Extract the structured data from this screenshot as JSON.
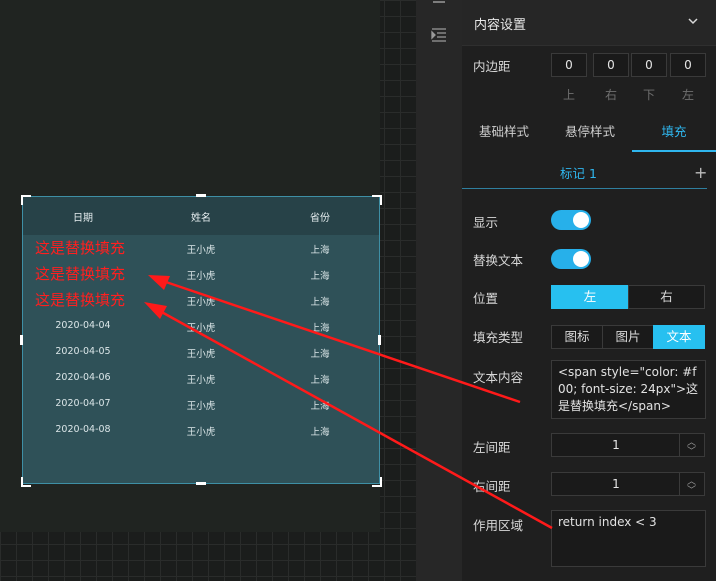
{
  "panel": {
    "title": "内容设置",
    "padding_label": "内边距",
    "padding_values": [
      "0",
      "0",
      "0",
      "0"
    ],
    "padding_sides": [
      "上",
      "右",
      "下",
      "左"
    ],
    "tabs": [
      "基础样式",
      "悬停样式",
      "填充"
    ],
    "mark_tab": "标记 1",
    "show_label": "显示",
    "replace_text_label": "替换文本",
    "position_label": "位置",
    "position_options": [
      "左",
      "右"
    ],
    "fill_type_label": "填充类型",
    "fill_type_options": [
      "图标",
      "图片",
      "文本"
    ],
    "text_content_label": "文本内容",
    "text_content_value": "<span style=\"color: #f00; font-size: 24px\">这是替换填充</span>",
    "left_spacing_label": "左间距",
    "left_spacing_value": "1",
    "right_spacing_label": "右间距",
    "right_spacing_value": "1",
    "scope_label": "作用区域",
    "scope_value": "return index < 3"
  },
  "table": {
    "headers": [
      "日期",
      "姓名",
      "省份"
    ],
    "fill_text": "这是替换填充",
    "rows": [
      {
        "date": "",
        "name": "王小虎",
        "province": "上海"
      },
      {
        "date": "",
        "name": "王小虎",
        "province": "上海"
      },
      {
        "date": "",
        "name": "王小虎",
        "province": "上海"
      },
      {
        "date": "2020-04-04",
        "name": "王小虎",
        "province": "上海"
      },
      {
        "date": "2020-04-05",
        "name": "王小虎",
        "province": "上海"
      },
      {
        "date": "2020-04-06",
        "name": "王小虎",
        "province": "上海"
      },
      {
        "date": "2020-04-07",
        "name": "王小虎",
        "province": "上海"
      },
      {
        "date": "2020-04-08",
        "name": "王小虎",
        "province": "上海"
      }
    ]
  },
  "icons": [
    "layers-icon",
    "indent-icon",
    "chevron-down-icon",
    "plus-icon"
  ],
  "colors": {
    "accent": "#27c0f0",
    "fill_text": "#ff1f1f",
    "arrow": "#ff1a1a"
  }
}
